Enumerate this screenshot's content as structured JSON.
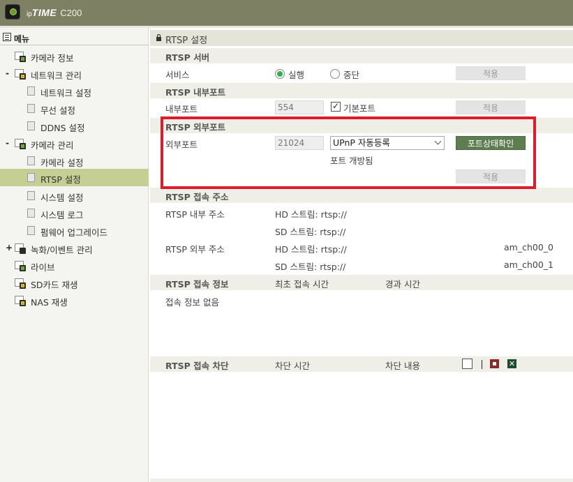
{
  "header": {
    "brand_prefix": "ip",
    "brand_name": "TIME",
    "model": "C200"
  },
  "sidebar": {
    "title": "메뉴",
    "items": [
      {
        "label": "카메라 정보"
      },
      {
        "label": "네트워크 관리",
        "expander": "-"
      },
      {
        "label": "네트워크 설정"
      },
      {
        "label": "무선 설정"
      },
      {
        "label": "DDNS 설정"
      },
      {
        "label": "카메라 관리",
        "expander": "-"
      },
      {
        "label": "카메라 설정"
      },
      {
        "label": "RTSP 설정"
      },
      {
        "label": "시스템 설정"
      },
      {
        "label": "시스템 로그"
      },
      {
        "label": "펌웨어 업그레이드"
      },
      {
        "label": "녹화/이벤트 관리",
        "expander": "+"
      },
      {
        "label": "라이브"
      },
      {
        "label": "SD카드 재생"
      },
      {
        "label": "NAS 재생"
      }
    ]
  },
  "main": {
    "title": "RTSP 설정",
    "server": {
      "heading": "RTSP 서버",
      "service_label": "서비스",
      "opt_run": "실행",
      "opt_stop": "중단",
      "apply": "적용"
    },
    "internal": {
      "heading": "RTSP 내부포트",
      "label": "내부포트",
      "port": "554",
      "default_port": "기본포트",
      "apply": "적용"
    },
    "external": {
      "heading": "RTSP 외부포트",
      "label": "외부포트",
      "port": "21024",
      "mode": "UPnP 자동등록",
      "check_button": "포트상태확인",
      "status": "포트 개방됨",
      "apply": "적용"
    },
    "address": {
      "heading": "RTSP 접속 주소",
      "internal_label": "RTSP 내부 주소",
      "external_label": "RTSP 외부 주소",
      "hd_int": "HD 스트림: rtsp://",
      "sd_int": "SD 스트림: rtsp://",
      "hd_ext": "HD 스트림: rtsp://",
      "sd_ext": "SD 스트림: rtsp://",
      "hd_ext_suffix": "am_ch00_0",
      "sd_ext_suffix": "am_ch00_1"
    },
    "access_info": {
      "heading": "RTSP 접속 정보",
      "col_first": "최초 접속 시간",
      "col_elapsed": "경과 시간",
      "empty": "접속 정보 없음"
    },
    "block": {
      "heading": "RTSP 접속 차단",
      "col_time": "차단 시간",
      "col_content": "차단 내용"
    }
  },
  "colors": {
    "topbar": "#7d8062",
    "active_nav": "#c5cf93",
    "highlight_box": "#e01b2a",
    "green_button": "#5e7e52"
  }
}
